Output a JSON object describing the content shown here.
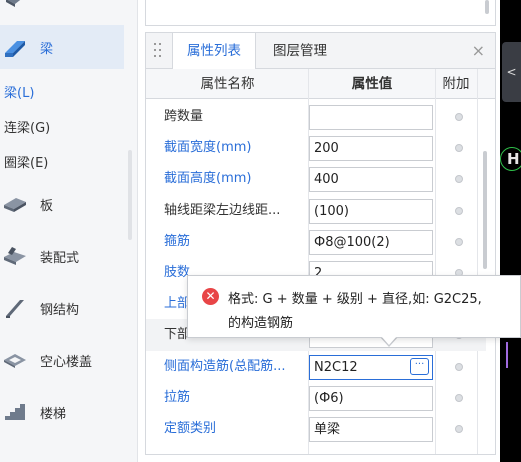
{
  "sidebar": {
    "top_partial_label": "",
    "items": [
      {
        "label": "梁",
        "icon": "beam-icon",
        "active": true
      },
      {
        "label": "板",
        "icon": "slab-icon"
      },
      {
        "label": "装配式",
        "icon": "prefab-icon"
      },
      {
        "label": "钢结构",
        "icon": "steel-structure-icon"
      },
      {
        "label": "空心楼盖",
        "icon": "hollow-floor-icon"
      },
      {
        "label": "楼梯",
        "icon": "stairs-icon"
      }
    ],
    "subitems": [
      {
        "label": "梁(L)",
        "active": true
      },
      {
        "label": "连梁(G)"
      },
      {
        "label": "圈梁(E)"
      }
    ]
  },
  "panel": {
    "tabs": [
      {
        "label": "属性列表",
        "active": true
      },
      {
        "label": "图层管理"
      }
    ],
    "close_label": "×",
    "columns": [
      "属性名称",
      "属性值",
      "附加"
    ],
    "rows": [
      {
        "name": "跨数量",
        "value": "",
        "blue": false
      },
      {
        "name": "截面宽度(mm)",
        "value": "200",
        "blue": true
      },
      {
        "name": "截面高度(mm)",
        "value": "400",
        "blue": true
      },
      {
        "name": "轴线距梁左边线距...",
        "value": "(100)",
        "blue": false
      },
      {
        "name": "箍筋",
        "value": "Ф8@100(2)",
        "blue": true
      },
      {
        "name": "肢数",
        "value": "2",
        "blue": true
      },
      {
        "name": "上部",
        "value": "",
        "blue": true
      },
      {
        "name": "下部",
        "value": "",
        "blue": false,
        "shaded": true
      },
      {
        "name": "侧面构造筋(总配筋...",
        "value": "N2C12",
        "blue": true,
        "focused": true
      },
      {
        "name": "拉筋",
        "value": "(Ф6)",
        "blue": true
      },
      {
        "name": "定额类别",
        "value": "单梁",
        "blue": true
      }
    ],
    "ellipsis_label": "···"
  },
  "tooltip": {
    "icon": "error-icon",
    "line1": "格式: G + 数量 + 级别 + 直径,如: G2C25,",
    "line2": "的构造钢筋"
  },
  "viewport": {
    "collapse_label": "<",
    "marker_label": "H"
  },
  "colors": {
    "accent": "#2a6ed8",
    "error": "#e84547",
    "sidebar_bg": "#f5f6f8",
    "active_bg": "#e3ebf6"
  }
}
